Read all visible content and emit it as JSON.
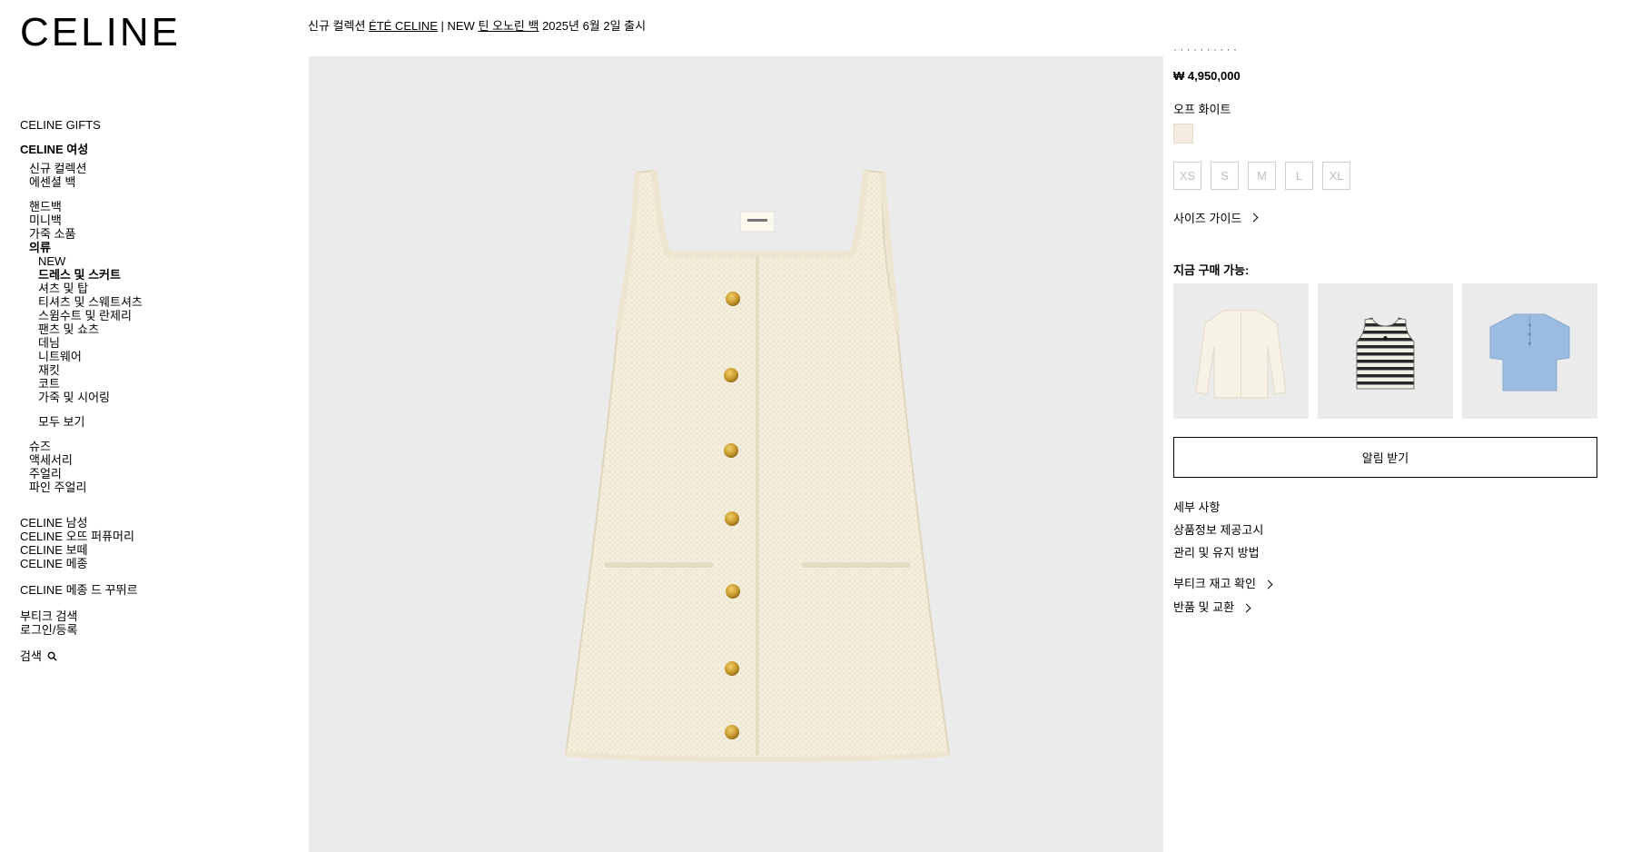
{
  "brand": {
    "logo": "CELINE"
  },
  "announcement": {
    "prefix": "신규 컬렉션 ",
    "link1": "ÉTÉ CELINE",
    "middle": " | NEW ",
    "link2": "틴 오노린 백",
    "suffix": " 2025년 6월 2일 출시"
  },
  "sidebar": {
    "gifts": "CELINE GIFTS",
    "women": "CELINE 여성",
    "new_collection": "신규 컬렉션",
    "essential_bags": "에센셜 백",
    "handbags": "핸드백",
    "mini_bags": "미니백",
    "leather_goods": "가죽 소품",
    "clothing": "의류",
    "clothing_items": [
      "NEW",
      "드레스 및 스커트",
      "셔츠 및 탑",
      "티셔츠 및 스웨트셔츠",
      "스윔수트 및 란제리",
      "팬츠 및 쇼츠",
      "데님",
      "니트웨어",
      "재킷",
      "코트",
      "가죽 및 시어링"
    ],
    "view_all": "모두 보기",
    "shoes": "슈즈",
    "accessories": "액세서리",
    "jewelry": "주얼리",
    "fine_jewelry": "파인 주얼리",
    "men": "CELINE 남성",
    "perfume": "CELINE 오뜨 퍼퓨머리",
    "beaute": "CELINE 보떼",
    "maison": "CELINE 메종",
    "maison_couture": "CELINE 메종 드 꾸뛰르",
    "boutique_search": "부티크 검색",
    "login": "로그인/등록",
    "search": "검색"
  },
  "product": {
    "price": "₩ 4,950,000",
    "color_name": "오프 화이트",
    "swatch_color": "#f3ecde",
    "sizes": [
      "XS",
      "S",
      "M",
      "L",
      "XL"
    ],
    "size_guide": "사이즈 가이드",
    "available_now": "지금 구매 가능:",
    "notify_button": "알림 받기",
    "details": "세부 사항",
    "product_info": "상품정보 제공고시",
    "care": "관리 및 유지 방법",
    "check_stock": "부티크 재고 확인",
    "returns": "반품 및 교환"
  }
}
